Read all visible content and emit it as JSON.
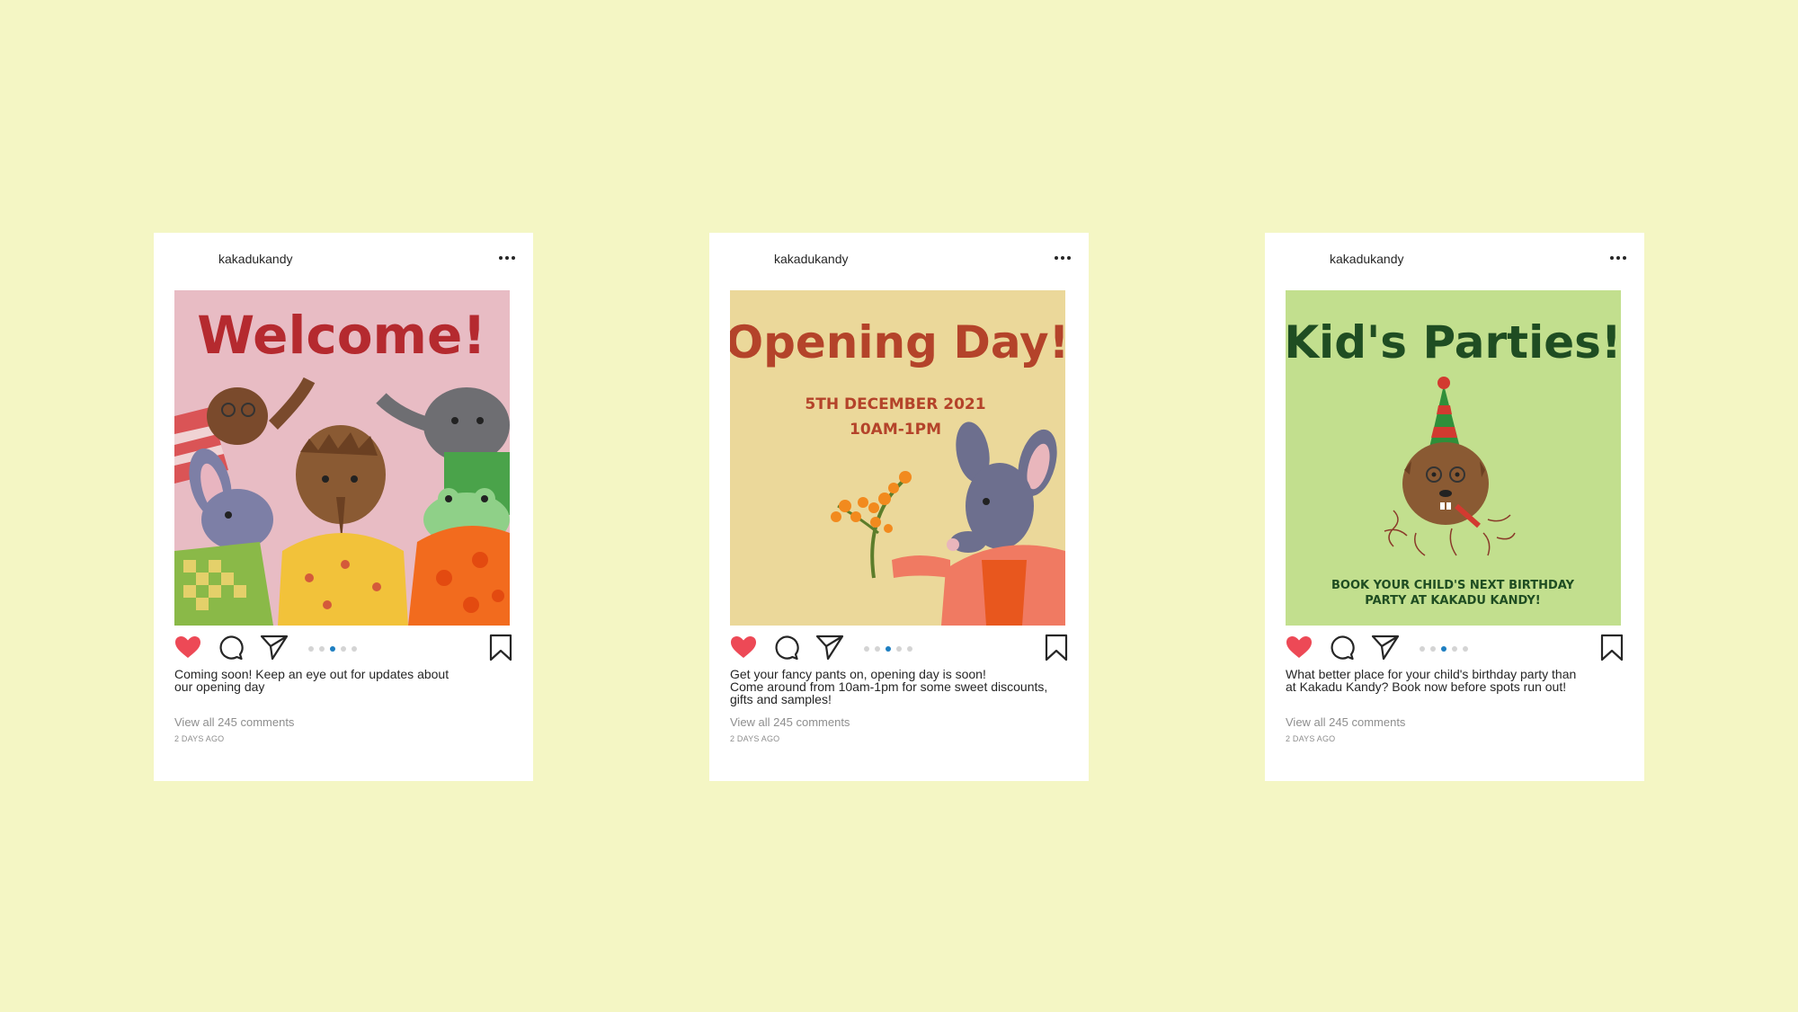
{
  "colors": {
    "page_background": "#f4f6c4",
    "heart": "#ed4956",
    "carousel_active": "#1e7fc1"
  },
  "posts": [
    {
      "username": "kakadukandy",
      "image_headline": "Welcome!",
      "image_background": "#e8bcc4",
      "caption": "Coming soon! Keep an eye out for updates about\nour opening day",
      "comments_link": "View all 245 comments",
      "time_ago": "2 DAYS AGO"
    },
    {
      "username": "kakadukandy",
      "image_headline": "Opening Day!",
      "image_subline_1": "5TH DECEMBER 2021",
      "image_subline_2": "10AM-1PM",
      "image_background": "#ebd89a",
      "caption": "Get your fancy pants on, opening day is soon!\nCome around from 10am-1pm for some sweet discounts,\ngifts and samples!",
      "comments_link": "View all 245 comments",
      "time_ago": "2 DAYS AGO"
    },
    {
      "username": "kakadukandy",
      "image_headline": "Kid's Parties!",
      "image_subline_1": "BOOK YOUR CHILD'S NEXT BIRTHDAY",
      "image_subline_2": "PARTY AT KAKADU KANDY!",
      "image_background": "#c2df8e",
      "caption": "What better place for your child's birthday party than\nat Kakadu Kandy? Book now before spots run out!",
      "comments_link": "View all 245 comments",
      "time_ago": "2 DAYS AGO"
    }
  ],
  "icons": {
    "like": "heart-icon",
    "comment": "comment-icon",
    "share": "send-icon",
    "save": "bookmark-icon",
    "more": "more-icon"
  }
}
